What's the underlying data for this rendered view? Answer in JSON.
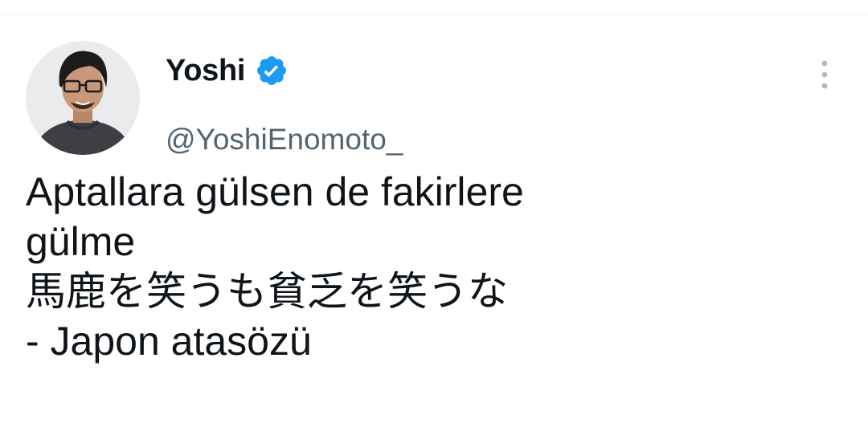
{
  "author": {
    "display_name": "Yoshi",
    "handle": "@YoshiEnomoto_",
    "verified": true
  },
  "tweet": {
    "lines": [
      "Aptallara gülsen de fakirlere",
      "gülme",
      "馬鹿を笑うも貧乏を笑うな",
      "- Japon atasözü"
    ]
  },
  "icons": {
    "verified": "verified-badge-icon",
    "more": "more-vertical-icon"
  },
  "colors": {
    "text": "#0f1419",
    "secondary": "#536471",
    "verified": "#1d9bf0",
    "more": "#b0bac1"
  }
}
